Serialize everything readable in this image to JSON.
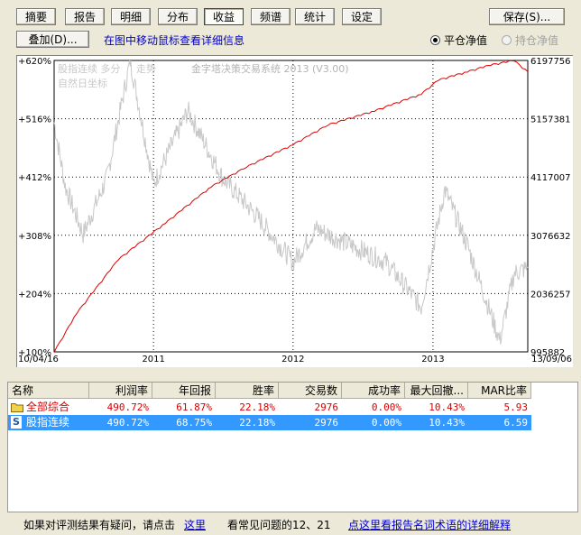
{
  "tabs": [
    {
      "label": "摘要",
      "active": false
    },
    {
      "label": "报告",
      "active": false
    },
    {
      "label": "明细",
      "active": false
    },
    {
      "label": "分布",
      "active": false
    },
    {
      "label": "收益",
      "active": true
    },
    {
      "label": "频谱",
      "active": false
    },
    {
      "label": "统计",
      "active": false
    },
    {
      "label": "设定",
      "active": false
    }
  ],
  "save_label": "保存(S)...",
  "overlay_label": "叠加(D)...",
  "hint": "在图中移动鼠标查看详细信息",
  "radio_options": [
    {
      "label": "平仓净值",
      "selected": true,
      "enabled": true
    },
    {
      "label": "持仓净值",
      "selected": false,
      "enabled": false
    }
  ],
  "chart": {
    "overlay_title": "股指连续  多分",
    "overlay_title2": "走势",
    "overlay_subtitle": "自然日坐标",
    "system_name": "金字塔决策交易系统 2013 (V3.00)",
    "left_ticks": [
      "+620%",
      "+516%",
      "+412%",
      "+308%",
      "+204%",
      "+100%"
    ],
    "right_ticks": [
      "6197756",
      "5157381",
      "4117007",
      "3076632",
      "2036257",
      "995882"
    ],
    "x_labels": [
      "10/04/16",
      "2011",
      "2012",
      "2013",
      "13/09/06"
    ]
  },
  "chart_data": {
    "type": "line",
    "x_range": [
      "2010-04-16",
      "2013-09-06"
    ],
    "x_ticks": [
      "2011",
      "2012",
      "2013"
    ],
    "y_left_range_pct": [
      100,
      620
    ],
    "y_right_range": [
      995882,
      6197756
    ],
    "series": [
      {
        "color": "#dd0000",
        "x": [
          "2010-04-16",
          "2010-06-15",
          "2010-10-01",
          "2011-02-01",
          "2011-06-01",
          "2011-09-01",
          "2012-01-01",
          "2012-04-01",
          "2012-08-01",
          "2012-12-01",
          "2013-01-15",
          "2013-04-01",
          "2013-06-01",
          "2013-08-01",
          "2013-09-06"
        ],
        "y": [
          100,
          170,
          265,
          330,
          395,
          430,
          470,
          505,
          530,
          560,
          585,
          600,
          612,
          620,
          600
        ]
      },
      {
        "color": "#c8c8c8",
        "x": [
          "2010-04-16",
          "2010-05-15",
          "2010-07-01",
          "2010-09-01",
          "2010-11-01",
          "2011-01-01",
          "2011-04-01",
          "2011-07-01",
          "2011-10-01",
          "2012-01-01",
          "2012-03-01",
          "2012-06-01",
          "2012-09-01",
          "2012-12-01",
          "2013-02-01",
          "2013-04-01",
          "2013-06-25",
          "2013-08-01",
          "2013-09-06"
        ],
        "y": [
          510,
          395,
          310,
          410,
          620,
          400,
          530,
          410,
          340,
          260,
          320,
          290,
          260,
          180,
          390,
          290,
          120,
          240,
          250
        ]
      }
    ]
  },
  "table": {
    "headers": [
      "名称",
      "利润率",
      "年回报",
      "胜率",
      "交易数",
      "成功率",
      "最大回撤...",
      "MAR比率"
    ],
    "rows": [
      {
        "name": "全部综合",
        "icon": "folder-icon",
        "cells": [
          "490.72%",
          "61.87%",
          "22.18%",
          "2976",
          "0.00%",
          "10.43%",
          "5.93"
        ],
        "selected": false
      },
      {
        "name": "股指连续",
        "icon": "s-badge-icon",
        "cells": [
          "490.72%",
          "68.75%",
          "22.18%",
          "2976",
          "0.00%",
          "10.43%",
          "6.59"
        ],
        "selected": true
      }
    ]
  },
  "footer": {
    "text1": "如果对评测结果有疑问，请点击",
    "link1": "这里",
    "text2": "看常见问题的12、21",
    "link2": "点这里看报告名词术语的详细解释"
  }
}
